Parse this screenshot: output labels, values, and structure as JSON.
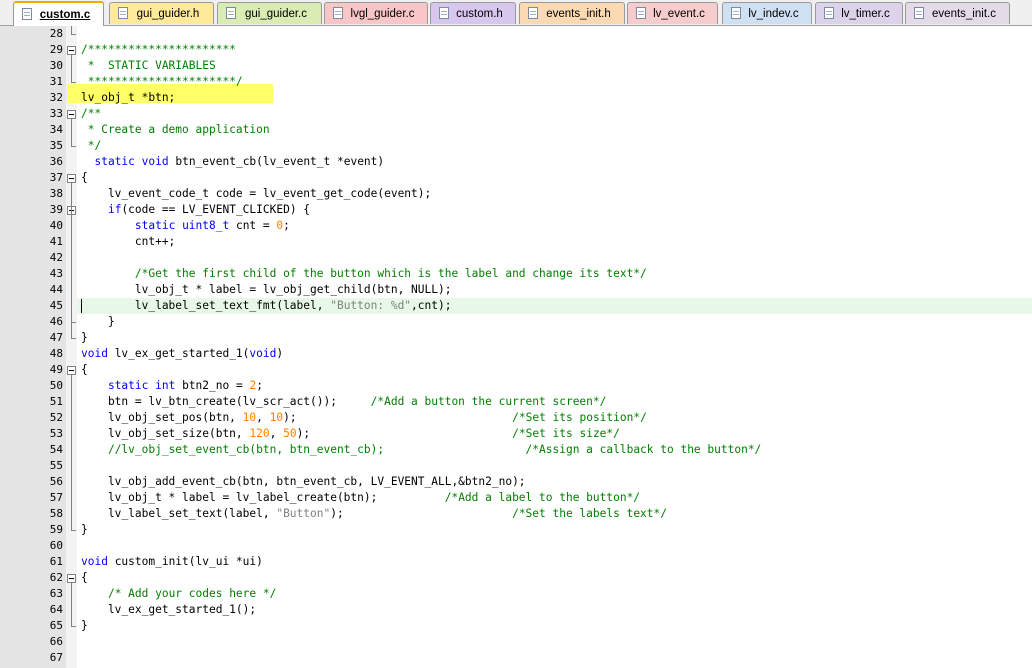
{
  "tabs": [
    {
      "label": "custom.c",
      "color": "#ffffff",
      "active": true
    },
    {
      "label": "gui_guider.h",
      "color": "#ffe99a",
      "active": false
    },
    {
      "label": "gui_guider.c",
      "color": "#d9ecb4",
      "active": false
    },
    {
      "label": "lvgl_guider.c",
      "color": "#f8c6c6",
      "active": false
    },
    {
      "label": "custom.h",
      "color": "#d7c7ef",
      "active": false
    },
    {
      "label": "events_init.h",
      "color": "#fbd9b3",
      "active": false
    },
    {
      "label": "lv_event.c",
      "color": "#f6cccc",
      "active": false
    },
    {
      "label": "lv_indev.c",
      "color": "#cfe0f3",
      "active": false
    },
    {
      "label": "lv_timer.c",
      "color": "#dcd2ea",
      "active": false
    },
    {
      "label": "events_init.c",
      "color": "#e4dbe9",
      "active": false
    }
  ],
  "colors": {
    "keyword": "#0000ff",
    "comment": "#008000",
    "number": "#ff8000",
    "string": "#808080",
    "current_line": "#e8f8e8",
    "highlight": "#ffff66"
  },
  "lines": [
    {
      "n": "28",
      "t": ""
    },
    {
      "n": "29",
      "t": "/**********************"
    },
    {
      "n": "30",
      "t": " *  STATIC VARIABLES"
    },
    {
      "n": "31",
      "t": " **********************/"
    },
    {
      "n": "32",
      "t": "lv_obj_t *btn;"
    },
    {
      "n": "33",
      "t": "/**"
    },
    {
      "n": "34",
      "t": " * Create a demo application"
    },
    {
      "n": "35",
      "t": " */"
    },
    {
      "n": "36",
      "t": "  static void btn_event_cb(lv_event_t *event)"
    },
    {
      "n": "37",
      "t": "{"
    },
    {
      "n": "38",
      "t": "    lv_event_code_t code = lv_event_get_code(event);"
    },
    {
      "n": "39",
      "t": "    if(code == LV_EVENT_CLICKED) {"
    },
    {
      "n": "40",
      "t": "        static uint8_t cnt = 0;"
    },
    {
      "n": "41",
      "t": "        cnt++;"
    },
    {
      "n": "42",
      "t": ""
    },
    {
      "n": "43",
      "t": "        /*Get the first child of the button which is the label and change its text*/"
    },
    {
      "n": "44",
      "t": "        lv_obj_t * label = lv_obj_get_child(btn, NULL);"
    },
    {
      "n": "45",
      "t": "        lv_label_set_text_fmt(label, \"Button: %d\",cnt);"
    },
    {
      "n": "46",
      "t": "    }"
    },
    {
      "n": "47",
      "t": "}"
    },
    {
      "n": "48",
      "t": "void lv_ex_get_started_1(void)"
    },
    {
      "n": "49",
      "t": "{"
    },
    {
      "n": "50",
      "t": "    static int btn2_no = 2;"
    },
    {
      "n": "51",
      "t": "    btn = lv_btn_create(lv_scr_act());     /*Add a button the current screen*/"
    },
    {
      "n": "52",
      "t": "    lv_obj_set_pos(btn, 10, 10);                                /*Set its position*/"
    },
    {
      "n": "53",
      "t": "    lv_obj_set_size(btn, 120, 50);                              /*Set its size*/"
    },
    {
      "n": "54",
      "t": "    //lv_obj_set_event_cb(btn, btn_event_cb);                     /*Assign a callback to the button*/"
    },
    {
      "n": "55",
      "t": ""
    },
    {
      "n": "56",
      "t": "    lv_obj_add_event_cb(btn, btn_event_cb, LV_EVENT_ALL,&btn2_no);"
    },
    {
      "n": "57",
      "t": "    lv_obj_t * label = lv_label_create(btn);          /*Add a label to the button*/"
    },
    {
      "n": "58",
      "t": "    lv_label_set_text(label, \"Button\");                         /*Set the labels text*/"
    },
    {
      "n": "59",
      "t": "}"
    },
    {
      "n": "60",
      "t": ""
    },
    {
      "n": "61",
      "t": "void custom_init(lv_ui *ui)"
    },
    {
      "n": "62",
      "t": "{"
    },
    {
      "n": "63",
      "t": "    /* Add your codes here */"
    },
    {
      "n": "64",
      "t": "    lv_ex_get_started_1();"
    },
    {
      "n": "65",
      "t": "}"
    },
    {
      "n": "66",
      "t": ""
    },
    {
      "n": "67",
      "t": ""
    }
  ]
}
